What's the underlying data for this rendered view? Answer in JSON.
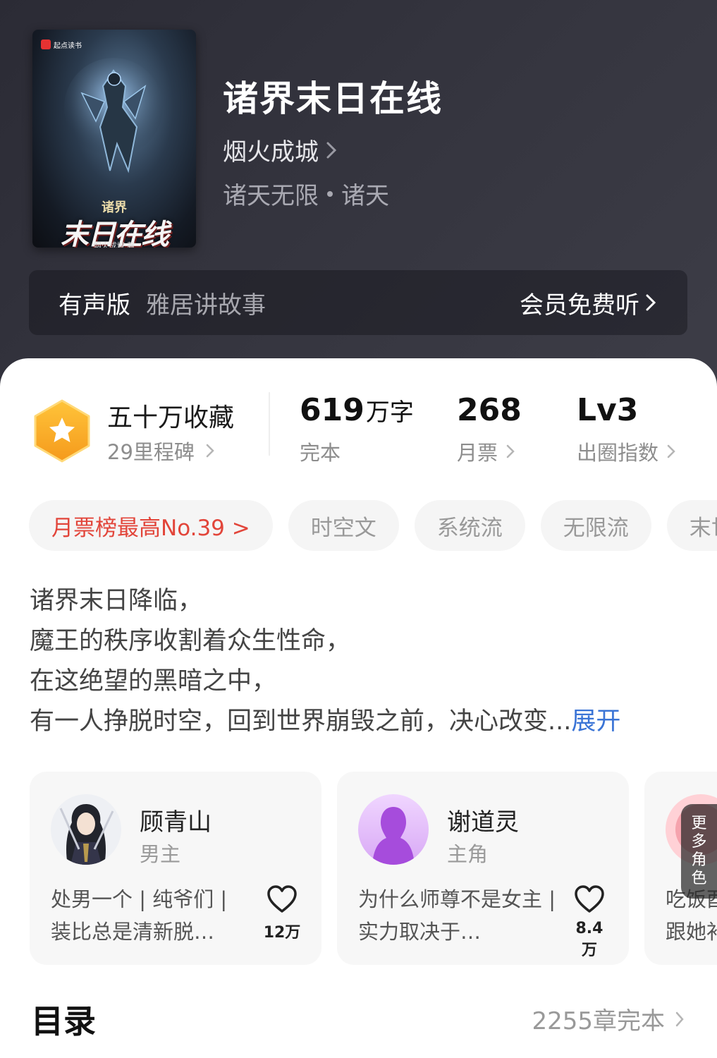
{
  "book": {
    "title": "诸界末日在线",
    "author": "烟火成城",
    "genre": "诸天无限",
    "subgenre": "诸天",
    "cover": {
      "publisher_mark": "起点读书",
      "cover_subtitle": "诸界",
      "cover_title": "末日在线",
      "cover_author": "烟火成城 著"
    }
  },
  "audio": {
    "label": "有声版",
    "narrator": "雅居讲故事",
    "action": "会员免费听"
  },
  "stats": {
    "collection": "五十万收藏",
    "milestone": "29里程碑",
    "word_count": "619",
    "word_unit": "万字",
    "status": "完本",
    "monthly_votes": "268",
    "monthly_votes_label": "月票",
    "influence": "Lv3",
    "influence_label": "出圈指数"
  },
  "tags": [
    {
      "label": "月票榜最高No.39 >"
    },
    {
      "label": "时空文"
    },
    {
      "label": "系统流"
    },
    {
      "label": "无限流"
    },
    {
      "label": "末世"
    }
  ],
  "synopsis": {
    "lines": [
      "诸界末日降临，",
      "魔王的秩序收割着众生性命，",
      "在这绝望的黑暗之中，",
      "有一人挣脱时空，回到世界崩毁之前，决心改变..."
    ],
    "expand": "展开"
  },
  "characters": [
    {
      "name": "顾青山",
      "role": "男主",
      "desc": "处男一个 | 纯爷们 | 装比总是清新脱…",
      "likes": "12万"
    },
    {
      "name": "谢道灵",
      "role": "主角",
      "desc": "为什么师尊不是女主 | 实力取决于…",
      "likes": "8.4万"
    },
    {
      "desc_line1": "吃饭酉",
      "desc_line2": "跟她补"
    }
  ],
  "more_roles": "更多角色",
  "toc": {
    "title": "目录",
    "status": "2255章完本"
  },
  "colors": {
    "accent_red": "#e2453a",
    "link_blue": "#3a74d6",
    "badge_orange": "#f6a623"
  }
}
